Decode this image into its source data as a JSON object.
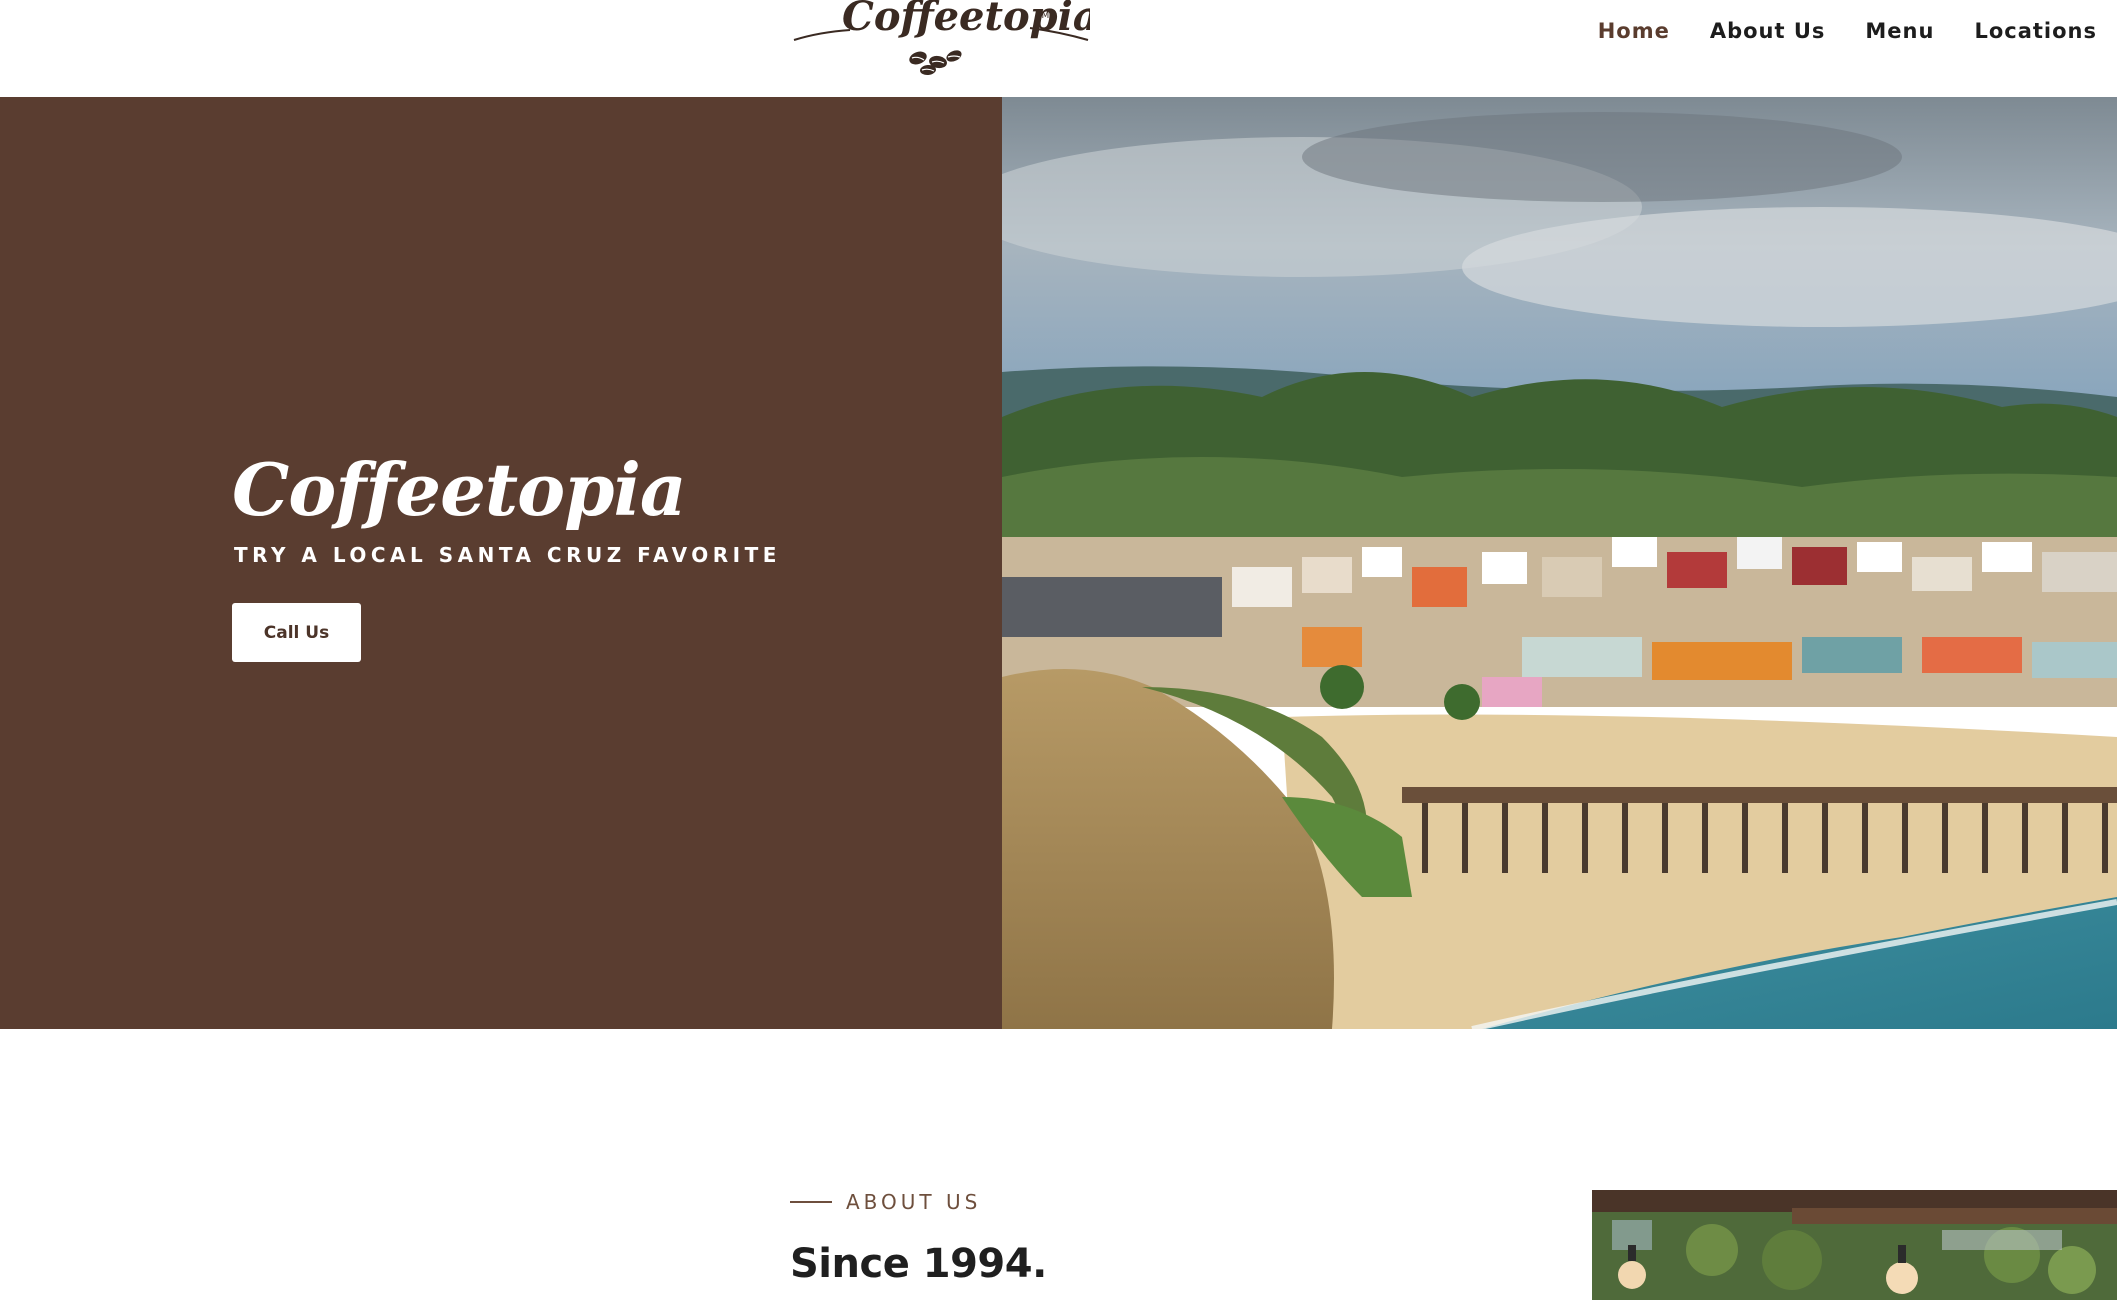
{
  "header": {
    "logo_text": "Coffeetopia™",
    "nav": {
      "home": "Home",
      "about": "About Us",
      "menu": "Menu",
      "locations": "Locations"
    }
  },
  "hero": {
    "title": "Coffeetopia",
    "subtitle": "TRY A LOCAL SANTA CRUZ FAVORITE",
    "cta_label": "Call Us"
  },
  "about": {
    "eyebrow": "ABOUT US",
    "heading": "Since 1994."
  },
  "colors": {
    "brand_brown": "#5a3d30",
    "nav_active": "#5a3c2e",
    "accent_text": "#6e4f3d"
  }
}
